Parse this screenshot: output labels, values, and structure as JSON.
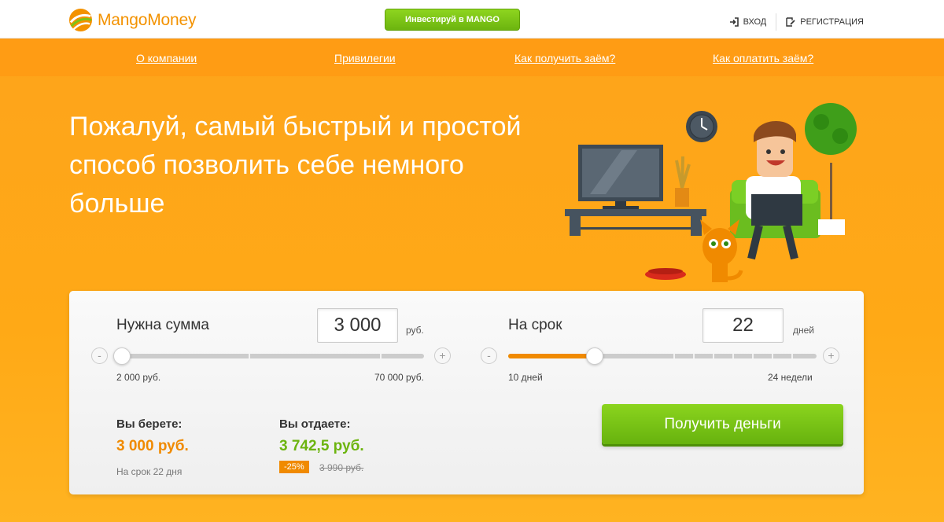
{
  "header": {
    "logo_text": "MangoMoney",
    "invest_label": "Инвестируй в MANGO",
    "login_label": "ВХОД",
    "register_label": "РЕГИСТРАЦИЯ"
  },
  "nav": {
    "items": [
      "О компании",
      "Привилегии",
      "Как получить заём?",
      "Как оплатить заём?"
    ]
  },
  "hero": {
    "headline": "Пожалуй, самый быстрый и простой способ позволить себе немного больше"
  },
  "calculator": {
    "amount": {
      "label": "Нужна сумма",
      "value": "3 000",
      "unit": "руб.",
      "min_label": "2 000 руб.",
      "max_label": "70 000 руб.",
      "level": 0.015
    },
    "term": {
      "label": "На срок",
      "value": "22",
      "unit": "дней",
      "min_label": "10 дней",
      "max_label": "24 недели",
      "level": 0.28
    },
    "take": {
      "label": "Вы берете:",
      "value": "3 000 руб.",
      "note": "На срок 22 дня"
    },
    "give": {
      "label": "Вы отдаете:",
      "value": "3 742,5 руб.",
      "discount": "-25%",
      "old_value": "3 990 руб."
    },
    "submit_label": "Получить деньги",
    "minus": "-",
    "plus": "+"
  },
  "colors": {
    "orange": "#f08a00",
    "green": "#7cc417",
    "brand": "#f39200"
  }
}
